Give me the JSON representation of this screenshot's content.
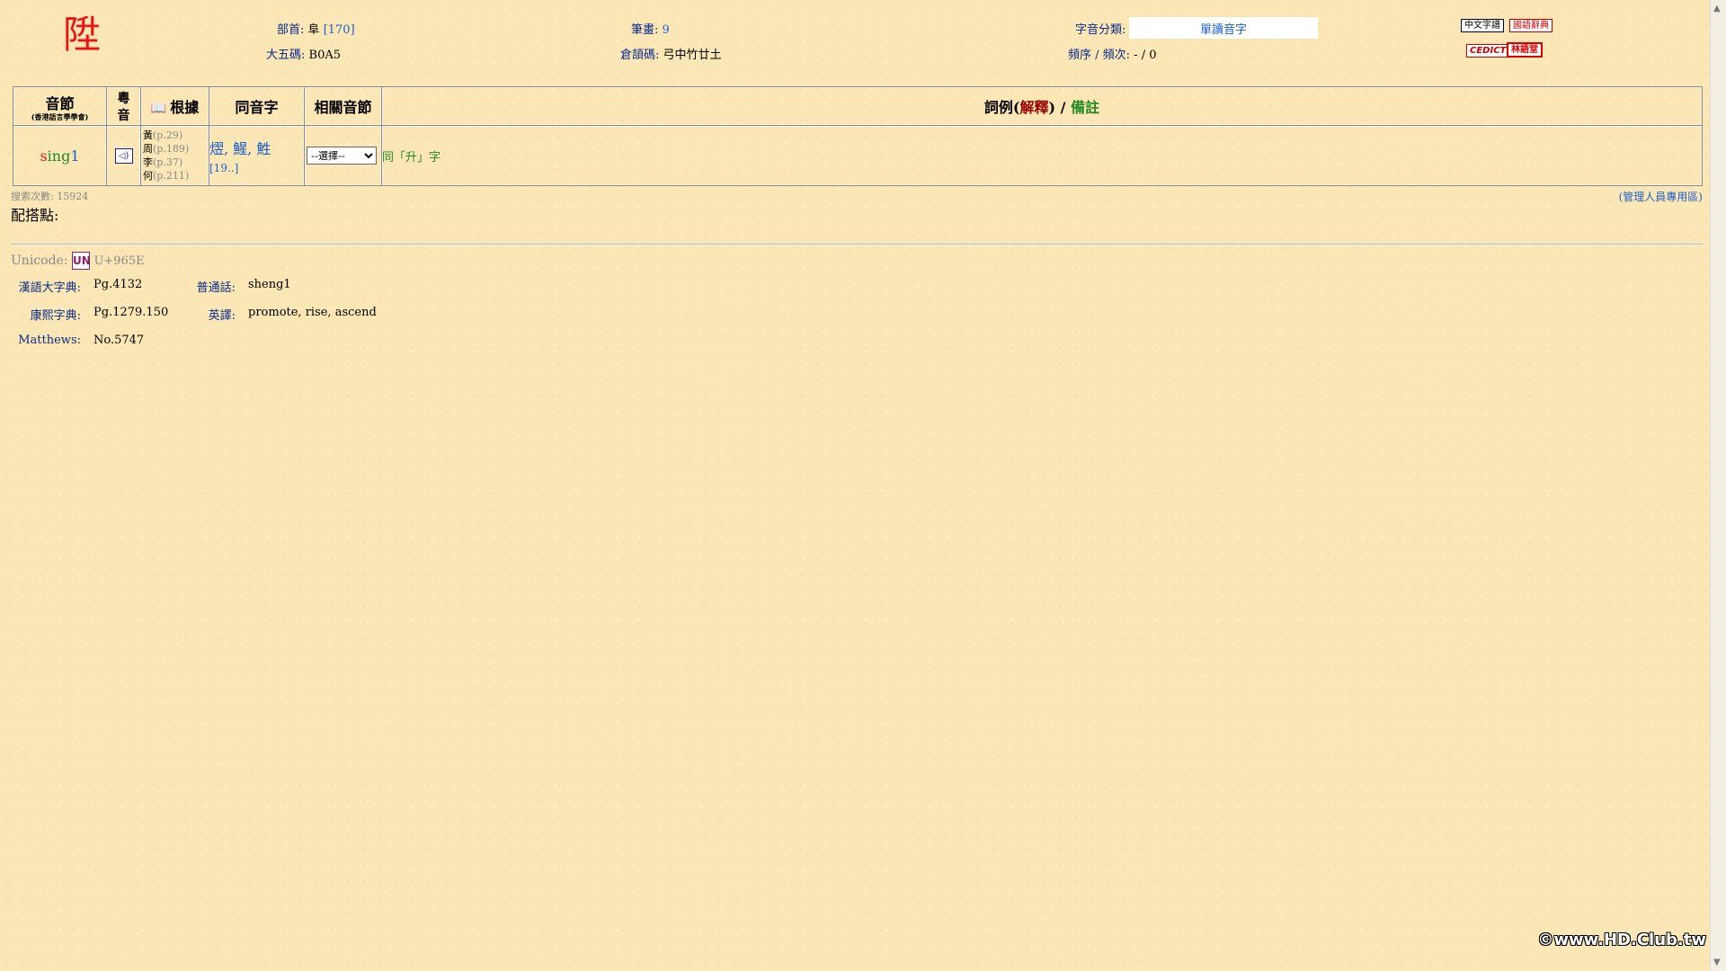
{
  "header": {
    "character": "陞",
    "radical": {
      "label": "部首:",
      "value": "阜",
      "number": "[170]"
    },
    "strokes": {
      "label": "筆畫:",
      "value": "9"
    },
    "category": {
      "label": "字音分類:",
      "value": "單讀音字"
    },
    "big5": {
      "label": "大五碼:",
      "value": "B0A5"
    },
    "cangjie": {
      "label": "倉頡碼:",
      "value": "弓中竹廿土"
    },
    "frequency": {
      "label": "頻序 / 頻次:",
      "value": "- / 0"
    },
    "links": {
      "zhongwen": "中文字譜",
      "guoyu": "國語辭典",
      "cedict": "CEDICT",
      "lam": "林語堂"
    }
  },
  "table": {
    "headers": {
      "syllable": "音節",
      "syllable_sub": "(香港語言學學會)",
      "audio_1": "粵",
      "audio_2": "音",
      "source": "根據",
      "homophones": "同音字",
      "related": "相關音節",
      "examples": "詞例",
      "examples_hint": "解釋",
      "notes_hint": "備註"
    },
    "row": {
      "syllable": {
        "initial": "s",
        "final": "ing",
        "tone": "1"
      },
      "sources": [
        {
          "name": "黃",
          "page": "(p.29)"
        },
        {
          "name": "周",
          "page": "(p.189)"
        },
        {
          "name": "李",
          "page": "(p.37)"
        },
        {
          "name": "何",
          "page": "(p.211)"
        }
      ],
      "homophones": "熤, 鯹, 鮏",
      "homophones_count": "[19..]",
      "related_select": "--選擇--",
      "example": "同「升」字"
    }
  },
  "search_count": "搜索次數: 15924",
  "admin_link": "(管理人員專用區)",
  "pairing_label": "配搭點:",
  "unicode": {
    "label": "Unicode:",
    "icon": "UN",
    "code": "U+965E"
  },
  "meta": {
    "hanyu": {
      "label": "漢語大字典:",
      "value": "Pg.4132"
    },
    "kangxi": {
      "label": "康熙字典:",
      "value": "Pg.1279.150"
    },
    "matthews": {
      "label": "Matthews:",
      "value": "No.5747"
    },
    "mandarin": {
      "label": "普通話:",
      "value": "sheng1"
    },
    "english": {
      "label": "英譯:",
      "value": "promote, rise, ascend"
    }
  },
  "watermark": "©www.HD.Club.tw"
}
